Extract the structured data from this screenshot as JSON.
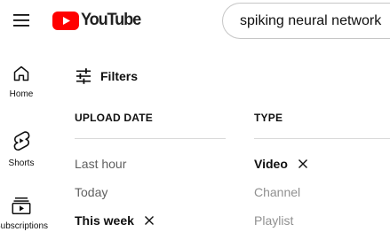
{
  "header": {
    "logo_text": "YouTube",
    "search_value": "spiking neural network"
  },
  "sidebar": {
    "items": [
      {
        "label": "Home",
        "icon": "home-icon"
      },
      {
        "label": "Shorts",
        "icon": "shorts-icon"
      },
      {
        "label": "Subscriptions",
        "icon": "subscriptions-icon"
      }
    ]
  },
  "filters": {
    "button_label": "Filters",
    "upload_date": {
      "heading": "UPLOAD DATE",
      "options": [
        {
          "label": "Last hour",
          "state": "normal"
        },
        {
          "label": "Today",
          "state": "normal"
        },
        {
          "label": "This week",
          "state": "selected"
        }
      ]
    },
    "type": {
      "heading": "TYPE",
      "options": [
        {
          "label": "Video",
          "state": "selected"
        },
        {
          "label": "Channel",
          "state": "disabled"
        },
        {
          "label": "Playlist",
          "state": "disabled"
        }
      ]
    }
  },
  "colors": {
    "brand_red": "#ff0000",
    "text_primary": "#0f0f0f",
    "text_secondary": "#606060",
    "text_disabled": "#909090"
  }
}
